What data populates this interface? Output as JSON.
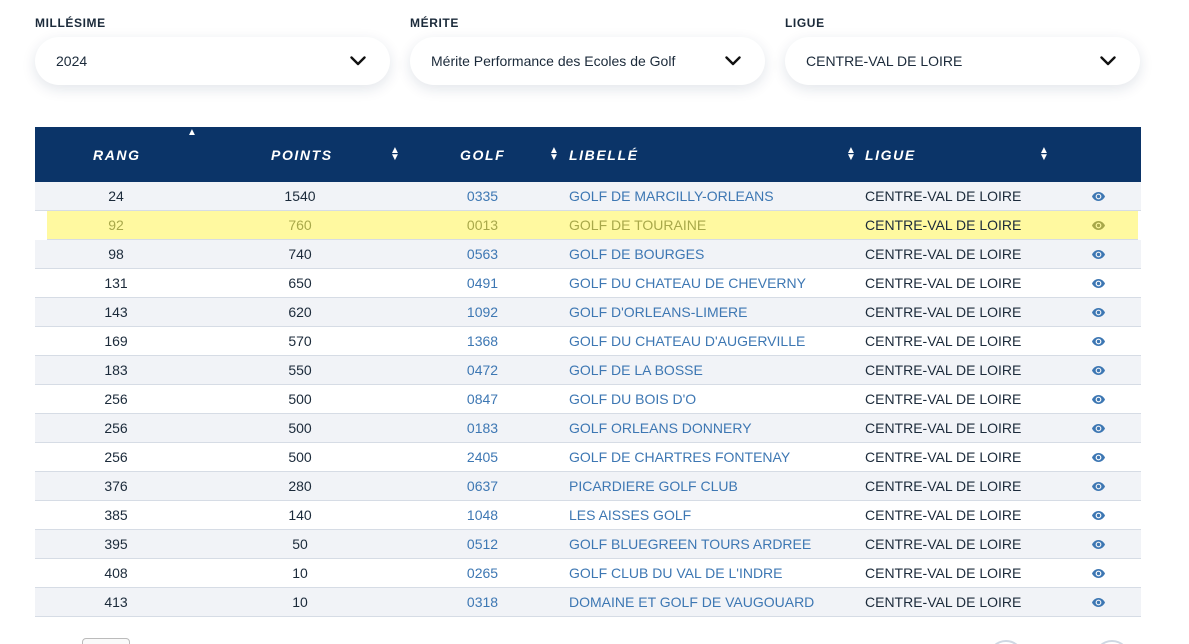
{
  "filters": {
    "millesime": {
      "label": "MILLÉSIME",
      "value": "2024"
    },
    "merite": {
      "label": "MÉRITE",
      "value": "Mérite Performance des Ecoles de Golf"
    },
    "ligue": {
      "label": "LIGUE",
      "value": "CENTRE-VAL DE LOIRE"
    }
  },
  "table": {
    "headers": {
      "rang": "RANG",
      "points": "POINTS",
      "golf": "GOLF",
      "libelle": "LIBELLÉ",
      "ligue": "LIGUE"
    },
    "sort_up_glyph": "▲",
    "sort_both_glyph": "▲▼",
    "highlighted_row_index": 1,
    "rows": [
      {
        "rang": "24",
        "points": "1540",
        "golf": "0335",
        "libelle": "GOLF DE MARCILLY-ORLEANS",
        "ligue": "CENTRE-VAL DE LOIRE"
      },
      {
        "rang": "92",
        "points": "760",
        "golf": "0013",
        "libelle": "GOLF DE TOURAINE",
        "ligue": "CENTRE-VAL DE LOIRE"
      },
      {
        "rang": "98",
        "points": "740",
        "golf": "0563",
        "libelle": "GOLF DE BOURGES",
        "ligue": "CENTRE-VAL DE LOIRE"
      },
      {
        "rang": "131",
        "points": "650",
        "golf": "0491",
        "libelle": "GOLF DU CHATEAU DE CHEVERNY",
        "ligue": "CENTRE-VAL DE LOIRE"
      },
      {
        "rang": "143",
        "points": "620",
        "golf": "1092",
        "libelle": "GOLF D'ORLEANS-LIMERE",
        "ligue": "CENTRE-VAL DE LOIRE"
      },
      {
        "rang": "169",
        "points": "570",
        "golf": "1368",
        "libelle": "GOLF DU CHATEAU D'AUGERVILLE",
        "ligue": "CENTRE-VAL DE LOIRE"
      },
      {
        "rang": "183",
        "points": "550",
        "golf": "0472",
        "libelle": "GOLF DE LA BOSSE",
        "ligue": "CENTRE-VAL DE LOIRE"
      },
      {
        "rang": "256",
        "points": "500",
        "golf": "0847",
        "libelle": "GOLF DU BOIS D'O",
        "ligue": "CENTRE-VAL DE LOIRE"
      },
      {
        "rang": "256",
        "points": "500",
        "golf": "0183",
        "libelle": "GOLF ORLEANS DONNERY",
        "ligue": "CENTRE-VAL DE LOIRE"
      },
      {
        "rang": "256",
        "points": "500",
        "golf": "2405",
        "libelle": "GOLF DE CHARTRES FONTENAY",
        "ligue": "CENTRE-VAL DE LOIRE"
      },
      {
        "rang": "376",
        "points": "280",
        "golf": "0637",
        "libelle": "PICARDIERE GOLF CLUB",
        "ligue": "CENTRE-VAL DE LOIRE"
      },
      {
        "rang": "385",
        "points": "140",
        "golf": "1048",
        "libelle": "LES AISSES GOLF",
        "ligue": "CENTRE-VAL DE LOIRE"
      },
      {
        "rang": "395",
        "points": "50",
        "golf": "0512",
        "libelle": "GOLF BLUEGREEN TOURS ARDREE",
        "ligue": "CENTRE-VAL DE LOIRE"
      },
      {
        "rang": "408",
        "points": "10",
        "golf": "0265",
        "libelle": "GOLF CLUB DU VAL DE L'INDRE",
        "ligue": "CENTRE-VAL DE LOIRE"
      },
      {
        "rang": "413",
        "points": "10",
        "golf": "0318",
        "libelle": "DOMAINE ET GOLF DE VAUGOUARD",
        "ligue": "CENTRE-VAL DE LOIRE"
      }
    ],
    "row_icon": "eye-icon"
  },
  "colors": {
    "header_bg": "#0b3468",
    "link": "#3d77b3",
    "highlight": "#fff9a0"
  }
}
